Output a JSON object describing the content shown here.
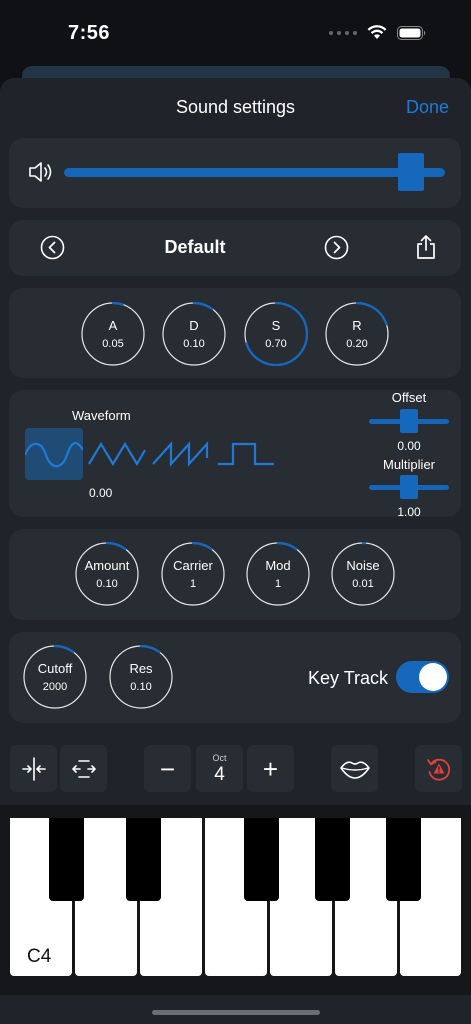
{
  "status_bar": {
    "time": "7:56"
  },
  "header": {
    "title": "Sound settings",
    "done_label": "Done"
  },
  "volume": {
    "level": 0.94
  },
  "preset": {
    "name": "Default"
  },
  "envelope": [
    {
      "label": "A",
      "value": "0.05",
      "fraction": 0.05
    },
    {
      "label": "D",
      "value": "0.10",
      "fraction": 0.1
    },
    {
      "label": "S",
      "value": "0.70",
      "fraction": 0.7
    },
    {
      "label": "R",
      "value": "0.20",
      "fraction": 0.2
    }
  ],
  "waveform": {
    "label": "Waveform",
    "value": "0.00",
    "options": [
      "sine",
      "triangle",
      "sawtooth",
      "square"
    ],
    "selected": "sine",
    "offset_label": "Offset",
    "offset_value": "0.00",
    "offset_fraction": 0.5,
    "multiplier_label": "Multiplier",
    "multiplier_value": "1.00",
    "multiplier_fraction": 0.5
  },
  "modulation": [
    {
      "label": "Amount",
      "value": "0.10",
      "fraction": 0.1
    },
    {
      "label": "Carrier",
      "value": "1",
      "fraction": 0.1
    },
    {
      "label": "Mod",
      "value": "1",
      "fraction": 0.1
    },
    {
      "label": "Noise",
      "value": "0.01",
      "fraction": 0.01
    }
  ],
  "filter": {
    "knobs": [
      {
        "label": "Cutoff",
        "value": "2000",
        "fraction": 0.1
      },
      {
        "label": "Res",
        "value": "0.10",
        "fraction": 0.1
      }
    ],
    "key_track_label": "Key Track",
    "key_track_on": true
  },
  "toolbar": {
    "octave_label": "Oct",
    "octave_value": "4",
    "minus_label": "−",
    "plus_label": "+"
  },
  "keyboard": {
    "start_note": "C4"
  },
  "colors": {
    "accent": "#1668bd",
    "panic": "#e0413b"
  }
}
